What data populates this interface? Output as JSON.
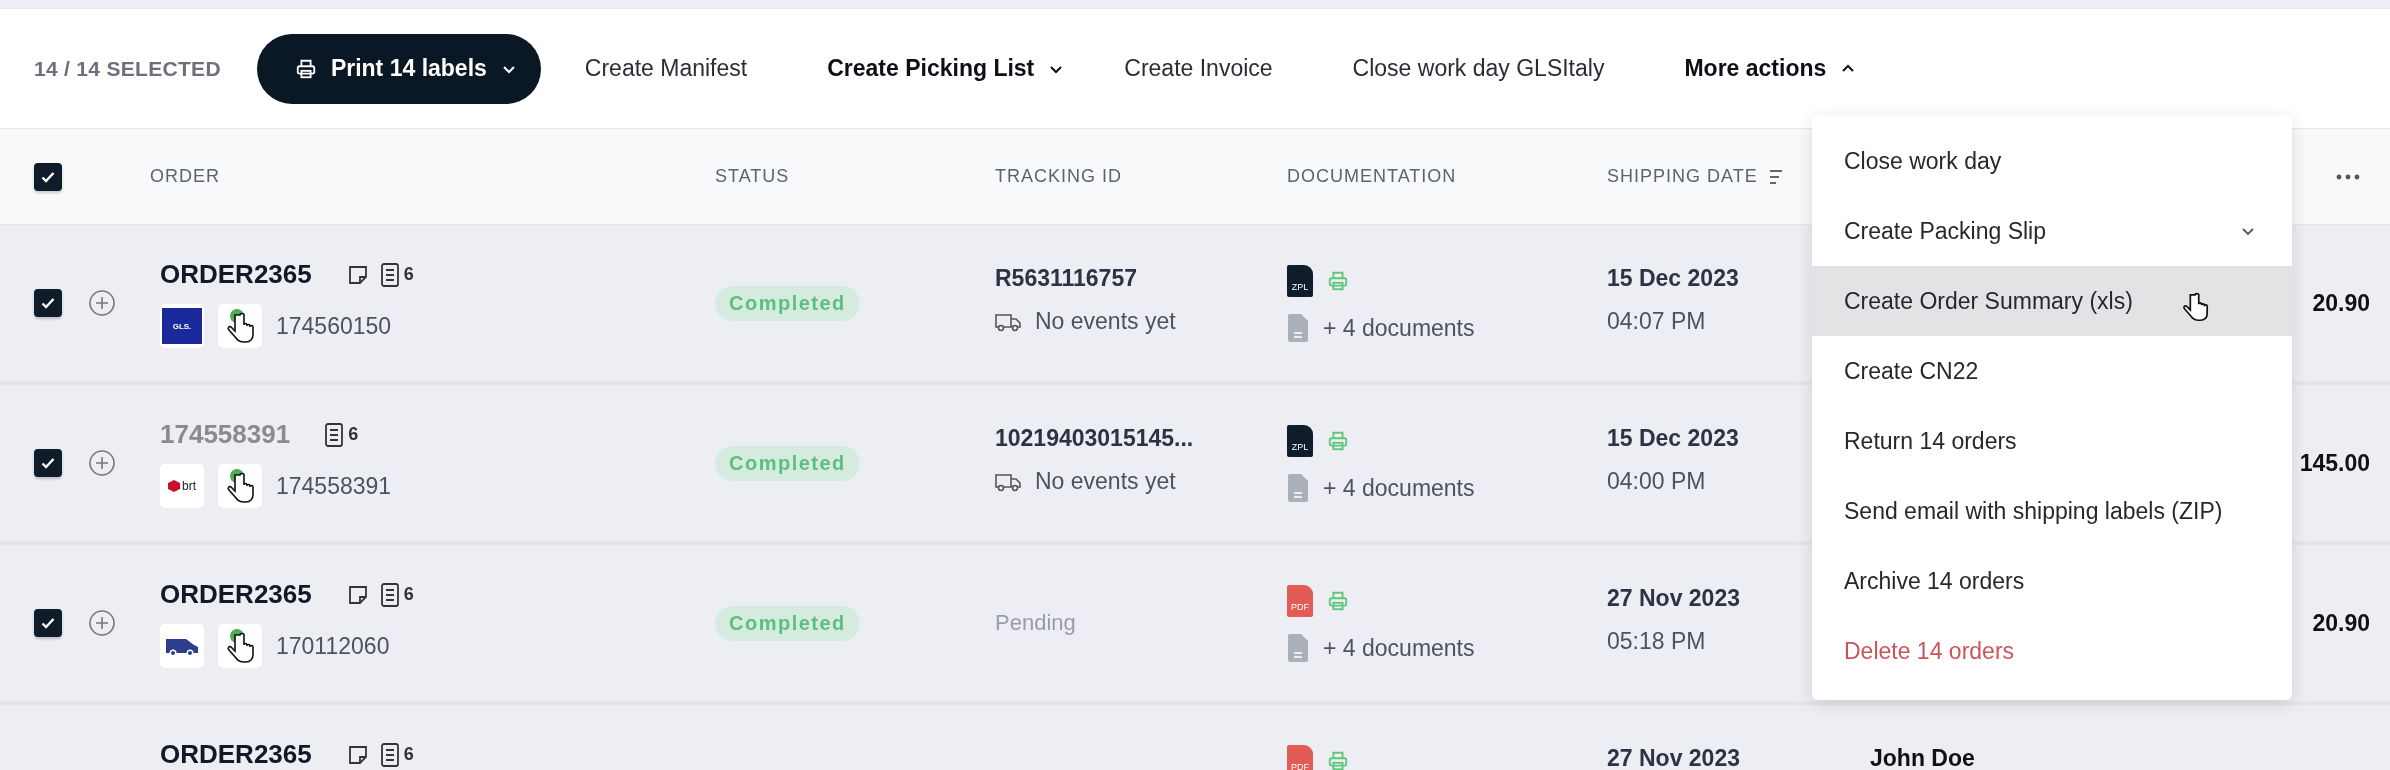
{
  "toolbar": {
    "selection_count": "14 / 14 SELECTED",
    "actions": [
      {
        "label": "Print 14 labels",
        "kind": "primary",
        "expanded": false
      },
      {
        "label": "Create Manifest",
        "kind": "plain"
      },
      {
        "label": "Create Picking List",
        "kind": "dropdown",
        "expanded": false
      },
      {
        "label": "Create Invoice",
        "kind": "plain"
      },
      {
        "label": "Close work day GLSItaly",
        "kind": "plain"
      },
      {
        "label": "More actions",
        "kind": "dropdown",
        "expanded": true
      }
    ]
  },
  "header": {
    "select_all_checked": true,
    "columns": [
      "ORDER",
      "STATUS",
      "TRACKING ID",
      "DOCUMENTATION",
      "SHIPPING DATE"
    ]
  },
  "rows": [
    {
      "checked": true,
      "order": "ORDER2365",
      "order_muted": false,
      "has_note": true,
      "doc_count": "6",
      "carrier": {
        "kind": "gls",
        "label": "GLS."
      },
      "order_id": "174560150",
      "status": {
        "kind": "completed",
        "label": "Completed"
      },
      "tracking": {
        "kind": "id",
        "text": "R5631116757",
        "events": "No events yet"
      },
      "doc": {
        "kind": "zpl",
        "label": "ZPL"
      },
      "more_docs": "+ 4 documents",
      "date": "15 Dec 2023",
      "time": "04:07 PM",
      "amount": "20.90"
    },
    {
      "checked": true,
      "order": "174558391",
      "order_muted": true,
      "has_note": false,
      "doc_count": "6",
      "carrier": {
        "kind": "brt",
        "label": "brt"
      },
      "order_id": "174558391",
      "status": {
        "kind": "completed",
        "label": "Completed"
      },
      "tracking": {
        "kind": "id",
        "text": "10219403015145...",
        "events": "No events yet"
      },
      "doc": {
        "kind": "zpl",
        "label": "ZPL"
      },
      "more_docs": "+ 4 documents",
      "date": "15 Dec 2023",
      "time": "04:00 PM",
      "amount": "145.00"
    },
    {
      "checked": true,
      "order": "ORDER2365",
      "order_muted": false,
      "has_note": true,
      "doc_count": "6",
      "carrier": {
        "kind": "van"
      },
      "order_id": "170112060",
      "status": {
        "kind": "completed",
        "label": "Completed"
      },
      "tracking": {
        "kind": "pending",
        "text": "Pending"
      },
      "doc": {
        "kind": "pdf",
        "label": "PDF"
      },
      "more_docs": "+ 4 documents",
      "date": "27 Nov 2023",
      "time": "05:18 PM",
      "amount": "20.90"
    },
    {
      "order": "ORDER2365",
      "order_muted": false,
      "has_note": true,
      "doc_count": "6",
      "doc": {
        "kind": "pdf",
        "label": "PDF"
      },
      "date": "27 Nov 2023",
      "customer": "John Doe"
    }
  ],
  "menu": {
    "items": [
      {
        "label": "Close work day",
        "kind": "plain",
        "hovered": false
      },
      {
        "label": "Create Packing Slip",
        "kind": "submenu",
        "hovered": false
      },
      {
        "label": "Create Order Summary (xls)",
        "kind": "plain",
        "hovered": true
      },
      {
        "label": "Create CN22",
        "kind": "plain",
        "hovered": false
      },
      {
        "label": "Return 14 orders",
        "kind": "plain",
        "hovered": false
      },
      {
        "label": "Send email with shipping labels (ZIP)",
        "kind": "plain",
        "hovered": false
      },
      {
        "label": "Archive 14 orders",
        "kind": "plain",
        "hovered": false
      },
      {
        "label": "Delete 14 orders",
        "kind": "danger",
        "hovered": false
      }
    ]
  }
}
